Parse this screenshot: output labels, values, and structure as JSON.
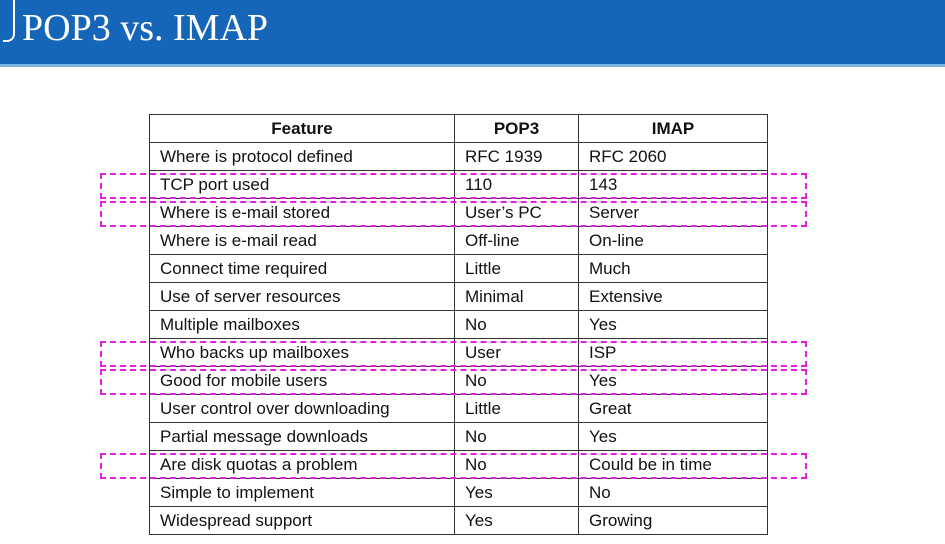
{
  "slide": {
    "title": "POP3 vs. IMAP"
  },
  "table": {
    "headers": [
      "Feature",
      "POP3",
      "IMAP"
    ],
    "rows": [
      [
        "Where is protocol defined",
        "RFC 1939",
        "RFC 2060"
      ],
      [
        "TCP port used",
        "110",
        "143"
      ],
      [
        "Where is e-mail stored",
        "User’s PC",
        "Server"
      ],
      [
        "Where is e-mail read",
        "Off-line",
        "On-line"
      ],
      [
        "Connect time required",
        "Little",
        "Much"
      ],
      [
        "Use of server resources",
        "Minimal",
        "Extensive"
      ],
      [
        "Multiple mailboxes",
        "No",
        "Yes"
      ],
      [
        "Who backs up mailboxes",
        "User",
        "ISP"
      ],
      [
        "Good for mobile users",
        "No",
        "Yes"
      ],
      [
        "User control over downloading",
        "Little",
        "Great"
      ],
      [
        "Partial message downloads",
        "No",
        "Yes"
      ],
      [
        "Are disk quotas a problem",
        "No",
        "Could be in time"
      ],
      [
        "Simple to implement",
        "Yes",
        "No"
      ],
      [
        "Widespread support",
        "Yes",
        "Growing"
      ]
    ],
    "highlighted_rows": [
      1,
      2,
      7,
      8,
      11
    ],
    "highlight_color": "#e21fe2"
  },
  "theme": {
    "header_color": "#1565b8",
    "title_color": "#ffffff"
  }
}
